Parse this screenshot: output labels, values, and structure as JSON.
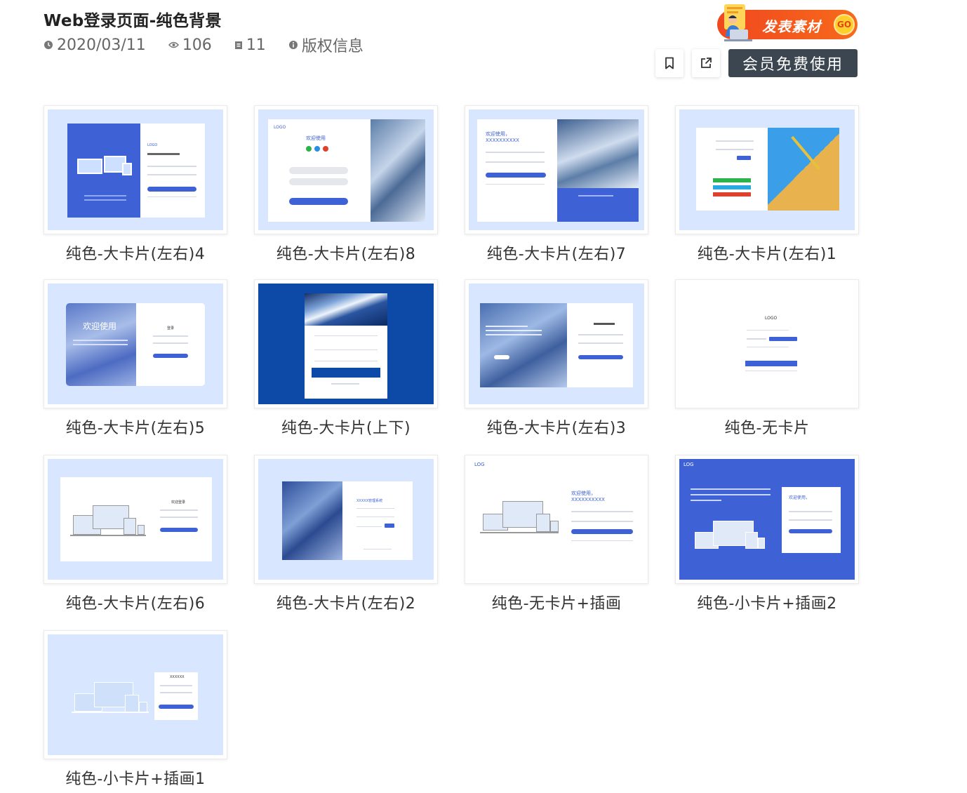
{
  "header": {
    "title": "Web登录页面-纯色背景",
    "date": "2020/03/11",
    "views": "106",
    "count": "11",
    "copyright": "版权信息"
  },
  "promo": {
    "text": "发表素材",
    "go": "GO"
  },
  "actions": {
    "member_label": "会员免费使用"
  },
  "colors": {
    "primary": "#3e62d6",
    "light_bg": "#d9e6ff",
    "dark_blue": "#0d4aa8",
    "button_dark": "#3b4650"
  },
  "thumb_text": {
    "logo": "LOGO",
    "log": "LOG",
    "welcome": "欢迎使用",
    "welcome_x": "欢迎使用，",
    "xname": "XXXXXXXXXX",
    "x6": "XXXXXX",
    "sys": "XXXXX管理系统",
    "login_title": "欢迎登录",
    "deng": "登录"
  },
  "templates": [
    {
      "caption": "纯色-大卡片(左右)4"
    },
    {
      "caption": "纯色-大卡片(左右)8"
    },
    {
      "caption": "纯色-大卡片(左右)7"
    },
    {
      "caption": "纯色-大卡片(左右)1"
    },
    {
      "caption": "纯色-大卡片(左右)5"
    },
    {
      "caption": "纯色-大卡片(上下)"
    },
    {
      "caption": "纯色-大卡片(左右)3"
    },
    {
      "caption": "纯色-无卡片"
    },
    {
      "caption": "纯色-大卡片(左右)6"
    },
    {
      "caption": "纯色-大卡片(左右)2"
    },
    {
      "caption": "纯色-无卡片+插画"
    },
    {
      "caption": "纯色-小卡片+插画2"
    },
    {
      "caption": "纯色-小卡片+插画1"
    }
  ]
}
